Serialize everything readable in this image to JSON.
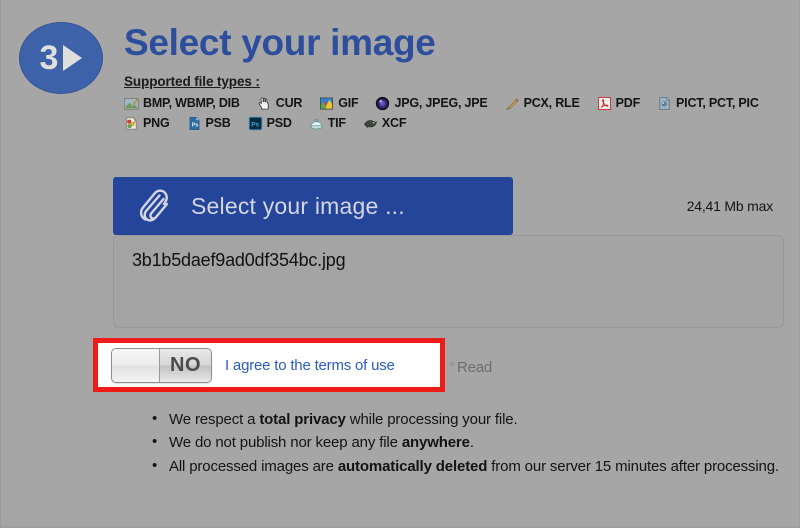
{
  "header": {
    "step_number": "3",
    "title": "Select your image",
    "supported_label": "Supported file types :"
  },
  "file_types": {
    "row1": [
      {
        "icon": "bmp-file-icon",
        "label": "BMP, WBMP, DIB"
      },
      {
        "icon": "cur-cursor-icon",
        "label": "CUR"
      },
      {
        "icon": "gif-file-icon",
        "label": "GIF"
      },
      {
        "icon": "jpg-file-icon",
        "label": "JPG, JPEG, JPE"
      },
      {
        "icon": "pcx-file-icon",
        "label": "PCX, RLE"
      },
      {
        "icon": "pdf-file-icon",
        "label": "PDF"
      },
      {
        "icon": "pict-file-icon",
        "label": "PICT, PCT, PIC"
      }
    ],
    "row2": [
      {
        "icon": "png-file-icon",
        "label": "PNG"
      },
      {
        "icon": "psb-file-icon",
        "label": "PSB"
      },
      {
        "icon": "psd-file-icon",
        "label": "PSD"
      },
      {
        "icon": "tif-file-icon",
        "label": "TIF"
      },
      {
        "icon": "xcf-file-icon",
        "label": "XCF"
      }
    ]
  },
  "select": {
    "button_label": "Select your image ...",
    "button_icon": "paperclip-icon",
    "max_size": "24,41 Mb max",
    "selected_file": "3b1b5daef9ad0df354bc.jpg"
  },
  "agree": {
    "toggle_state": "NO",
    "link_label": "I agree to the terms of use",
    "separator": "»",
    "read_label": "Read"
  },
  "notes": [
    {
      "pre": "We respect a ",
      "bold": "total privacy",
      "post": " while processing your file."
    },
    {
      "pre": "We do not publish nor keep any file ",
      "bold": "anywhere",
      "post": "."
    },
    {
      "pre": "All processed images are ",
      "bold": "automatically deleted",
      "post": " from our server 15 minutes after processing."
    }
  ],
  "colors": {
    "background": "#a6a6a6",
    "title_blue": "#2d4e9c",
    "badge_blue": "#3d62aa",
    "button_blue": "#24459a",
    "link_blue": "#2b5bbf",
    "highlight_red": "#ee1b16"
  }
}
